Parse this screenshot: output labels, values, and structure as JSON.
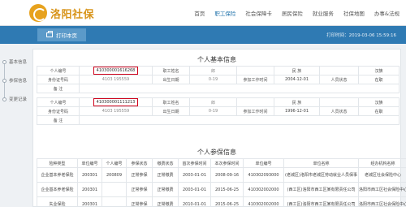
{
  "header": {
    "logo_text": "洛阳社保",
    "nav": [
      "首页",
      "职工保险",
      "社会保障卡",
      "居民保险",
      "就业服务",
      "社保地图",
      "办事&法规"
    ],
    "active_nav": 1
  },
  "toolbar": {
    "print_label": "打印本页",
    "print_time": "打印时间：2019-03-06 15:59:16"
  },
  "sidebar": {
    "items": [
      "基本信息",
      "参保信息",
      "变更记录"
    ]
  },
  "basic_info": {
    "title": "个人基本信息",
    "persons": [
      {
        "labels": [
          "个人编号",
          "职工姓名",
          "民  族",
          "身份证号码",
          "出生日期",
          "参加工作时间",
          "人员状态",
          "备  注"
        ],
        "id_no": "410300001616268",
        "name": "郎",
        "ethnicity": "汉族",
        "id_card": "4103          195559",
        "birth": "0-19",
        "work_start": "2004-12-01",
        "status": "在职",
        "note": ""
      },
      {
        "labels": [
          "个人编号",
          "职工姓名",
          "民  族",
          "身份证号码",
          "出生日期",
          "参加工作时间",
          "人员状态",
          "备  注"
        ],
        "id_no": "410300001111213",
        "name": "郎",
        "ethnicity": "汉族",
        "id_card": "4103          195559",
        "birth": "0-19",
        "work_start": "1996-12-01",
        "status": "在职",
        "note": ""
      }
    ]
  },
  "insurance_info": {
    "title": "个人参保信息",
    "headers": [
      "险种类型",
      "单位编号",
      "个人编号",
      "参保状态",
      "缴费状态",
      "首次参保时间",
      "本次参保时间",
      "单位编号",
      "单位名称",
      "经办机构名称"
    ],
    "rows": [
      [
        "企业基本养老保险",
        "200301",
        "200809",
        "正常参保",
        "正常缴费",
        "2003-01-01",
        "2008-09-16",
        "410302093000",
        "(老城区)洛阳市老城区劳动就业人员保事",
        "老城区社会保险中心"
      ],
      [
        "企业基本养老保险",
        "200301",
        "",
        "正常参保",
        "正常缴费",
        "2003-01-01",
        "2015-06-25",
        "410302002000",
        "(西工区)洛阳市西工区某有限责任公司",
        "洛阳市西工区社会保险中心"
      ],
      [
        "失业保险",
        "200301",
        "",
        "正常参保",
        "正常缴费",
        "2010-01-01",
        "2015-06-25",
        "410302002000",
        "(西工区)洛阳市西工区某有限责任公司",
        "洛阳市西工区社会保险中心"
      ]
    ]
  }
}
